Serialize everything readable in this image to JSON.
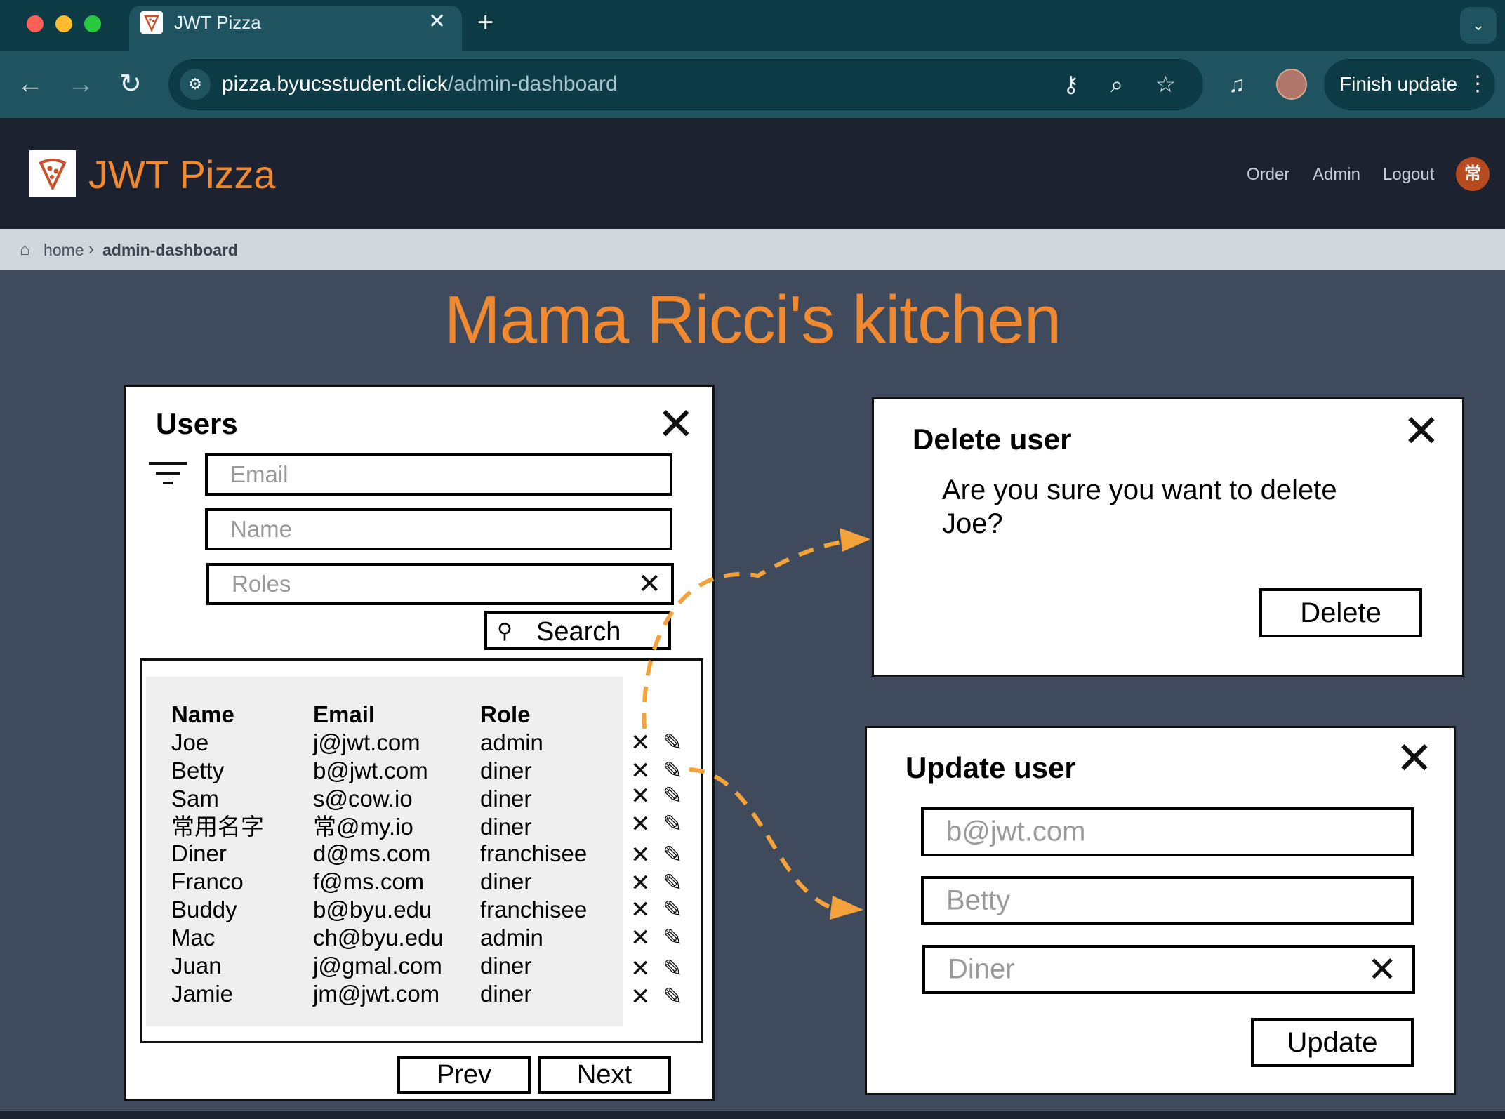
{
  "browser": {
    "tab_title": "JWT Pizza",
    "tab_close": "✕",
    "new_tab": "+",
    "tab_menu": "⌄",
    "url_host": "pizza.byucsstudent.click",
    "url_path": "/admin-dashboard",
    "finish_update_label": "Finish update",
    "icons": [
      "back-icon",
      "forward-icon",
      "reload-icon",
      "site-info-icon",
      "key-icon",
      "zoom-icon",
      "star-icon",
      "media-icon",
      "profile-avatar",
      "more-icon"
    ]
  },
  "header": {
    "brand": "JWT Pizza",
    "nav": [
      "Order",
      "Admin",
      "Logout"
    ],
    "avatar_text": "常"
  },
  "breadcrumb": {
    "home": "home",
    "current": "admin-dashboard"
  },
  "page": {
    "title": "Mama Ricci's kitchen"
  },
  "users_panel": {
    "title": "Users",
    "email_placeholder": "Email",
    "name_placeholder": "Name",
    "roles_placeholder": "Roles",
    "search_label": "Search",
    "columns": [
      "Name",
      "Email",
      "Role"
    ],
    "rows": [
      {
        "name": "Joe",
        "email": "j@jwt.com",
        "role": "admin"
      },
      {
        "name": "Betty",
        "email": "b@jwt.com",
        "role": "diner"
      },
      {
        "name": "Sam",
        "email": "s@cow.io",
        "role": "diner"
      },
      {
        "name": "常用名字",
        "email": "常@my.io",
        "role": "diner"
      },
      {
        "name": "Diner",
        "email": "d@ms.com",
        "role": "franchisee"
      },
      {
        "name": "Franco",
        "email": "f@ms.com",
        "role": "diner"
      },
      {
        "name": "Buddy",
        "email": "b@byu.edu",
        "role": "franchisee"
      },
      {
        "name": "Mac",
        "email": "ch@byu.edu",
        "role": "admin"
      },
      {
        "name": "Juan",
        "email": "j@gmal.com",
        "role": "diner"
      },
      {
        "name": "Jamie",
        "email": "jm@jwt.com",
        "role": "diner"
      }
    ],
    "prev_label": "Prev",
    "next_label": "Next"
  },
  "delete_panel": {
    "title": "Delete user",
    "message_line1": "Are you sure you want to delete",
    "message_line2": "Joe?",
    "delete_label": "Delete"
  },
  "update_panel": {
    "title": "Update user",
    "email_value": "b@jwt.com",
    "name_value": "Betty",
    "role_value": "Diner",
    "update_label": "Update"
  },
  "colors": {
    "brand_orange": "#f0892f",
    "chrome_dark": "#0c3a45",
    "chrome_mid": "#1f5360",
    "header_bg": "#1d2230",
    "page_bg": "#3f4a5c",
    "arrow": "#f4a23c"
  }
}
